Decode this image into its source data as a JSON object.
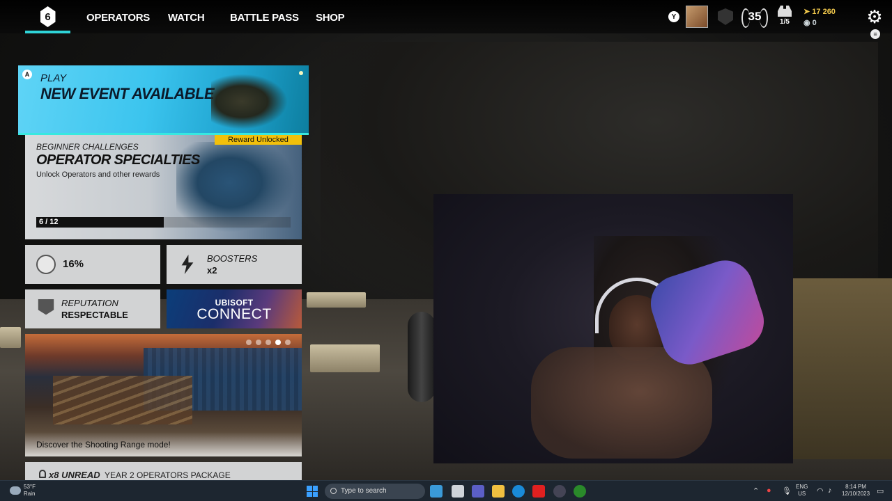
{
  "nav": {
    "logo_glyph": "6",
    "items": [
      "OPERATORS",
      "WATCH",
      "BATTLE PASS",
      "SHOP"
    ]
  },
  "profile": {
    "y_button": "Y",
    "level": "35",
    "squad": "1/5",
    "renown": "17 260",
    "credits": "0",
    "menu_glyph": "≡"
  },
  "play_tile": {
    "badge": "A",
    "label": "PLAY",
    "title": "NEW EVENT AVAILABLE"
  },
  "challenge": {
    "reward_badge": "Reward Unlocked",
    "subtitle": "BEGINNER CHALLENGES",
    "title": "OPERATOR SPECIALTIES",
    "description": "Unlock Operators and other rewards",
    "progress_text": "6 / 12",
    "progress_fraction": 0.5
  },
  "tiles": {
    "percent_value": "16%",
    "boosters_label": "BOOSTERS",
    "boosters_value": "x2",
    "reputation_label": "REPUTATION",
    "reputation_value": "RESPECTABLE"
  },
  "ubisoft": {
    "line1": "UBISOFT",
    "line2": "CONNECT"
  },
  "range": {
    "caption": "Discover the Shooting Range mode!"
  },
  "unread": {
    "count": "x8 UNREAD",
    "title": "YEAR 2 OPERATORS PACKAGE"
  },
  "taskbar": {
    "temp": "53°F",
    "condition": "Rain",
    "search_placeholder": "Type to search",
    "lang_top": "ENG",
    "lang_bottom": "US",
    "time": "8:14 PM",
    "date": "12/10/2023"
  },
  "colors": {
    "accent_cyan": "#2fd4d8",
    "reward_yellow": "#f2c00b",
    "renown_gold": "#f2c94c"
  }
}
